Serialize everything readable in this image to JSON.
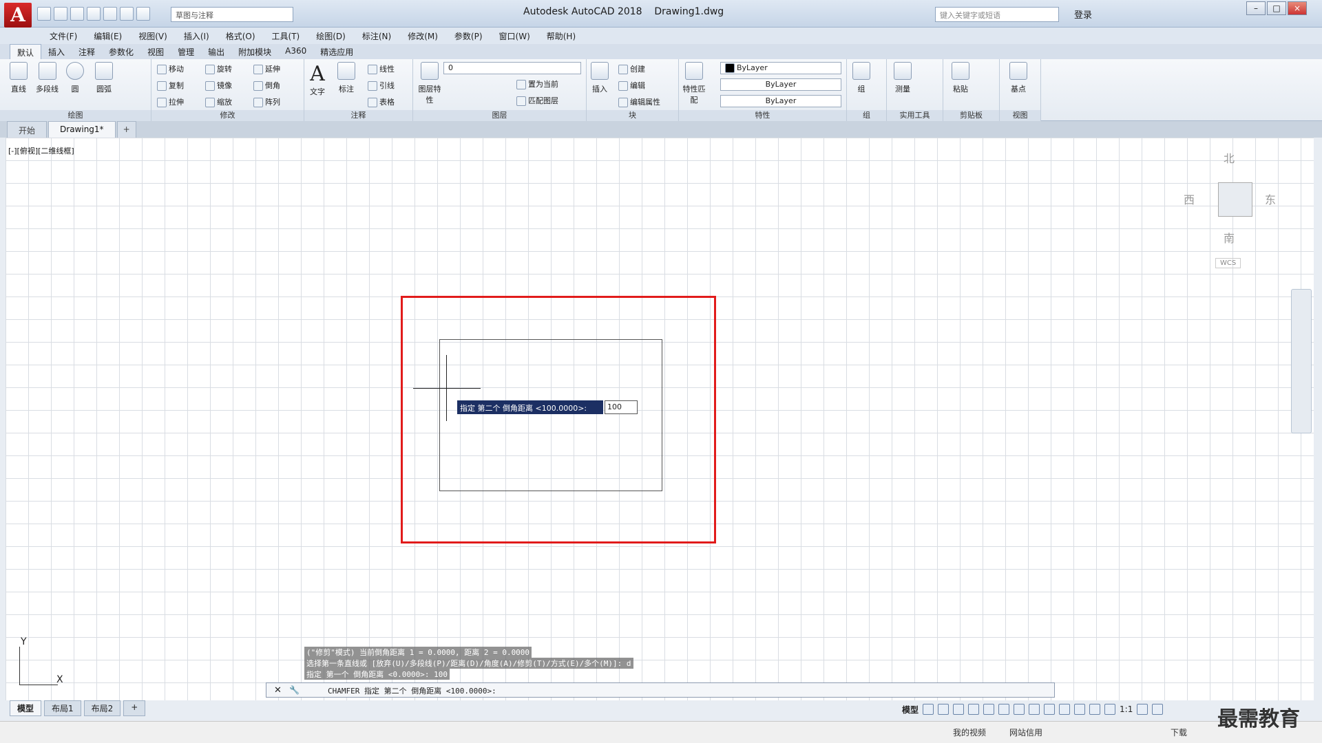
{
  "app": {
    "logo": "A",
    "title": "Autodesk AutoCAD 2018",
    "document": "Drawing1.dwg",
    "workspace": "草图与注释",
    "search_placeholder": "键入关键字或短语",
    "login": "登录"
  },
  "menu": [
    "文件(F)",
    "编辑(E)",
    "视图(V)",
    "插入(I)",
    "格式(O)",
    "工具(T)",
    "绘图(D)",
    "标注(N)",
    "修改(M)",
    "参数(P)",
    "窗口(W)",
    "帮助(H)"
  ],
  "ribbon_tabs": [
    "默认",
    "插入",
    "注释",
    "参数化",
    "视图",
    "管理",
    "输出",
    "附加模块",
    "A360",
    "精选应用"
  ],
  "panels": {
    "draw": {
      "title": "绘图",
      "tools": [
        "直线",
        "多段线",
        "圆",
        "圆弧"
      ]
    },
    "modify": {
      "title": "修改",
      "tools": [
        "移动",
        "旋转",
        "延伸",
        "复制",
        "镜像",
        "倒角",
        "拉伸",
        "缩放",
        "阵列"
      ]
    },
    "annotation": {
      "title": "注释",
      "tools": [
        "文字",
        "标注",
        "线性",
        "引线",
        "表格"
      ]
    },
    "layers": {
      "title": "图层",
      "tools": [
        "图层特性",
        "置为当前",
        "匹配图层"
      ],
      "current_layer": "0"
    },
    "block": {
      "title": "块",
      "tools": [
        "插入",
        "创建",
        "编辑",
        "编辑属性"
      ]
    },
    "properties": {
      "title": "特性",
      "tools": [
        "特性匹配"
      ],
      "color": "ByLayer",
      "linetype": "ByLayer",
      "lineweight": "ByLayer"
    },
    "groups": {
      "title": "组",
      "tools": [
        "组"
      ]
    },
    "utilities": {
      "title": "实用工具",
      "tools": [
        "测量"
      ]
    },
    "clipboard": {
      "title": "剪贴板",
      "tools": [
        "粘贴"
      ]
    },
    "view": {
      "title": "视图",
      "tools": [
        "基点"
      ]
    }
  },
  "doc_tabs": [
    "开始",
    "Drawing1*"
  ],
  "viewport_label": "[-][俯视][二维线框]",
  "viewcube": {
    "north": "北",
    "south": "南",
    "east": "东",
    "west": "西",
    "wcs": "WCS"
  },
  "dynamic_input": {
    "prompt": "指定 第二个 倒角距离 <100.0000>:",
    "value": "100"
  },
  "history": [
    "(\"修剪\"模式) 当前倒角距离 1 = 0.0000, 距离 2 = 0.0000",
    "选择第一条直线或 [放弃(U)/多段线(P)/距离(D)/角度(A)/修剪(T)/方式(E)/多个(M)]: d",
    "指定 第一个 倒角距离 <0.0000>: 100"
  ],
  "command_line": "CHAMFER 指定 第二个 倒角距离 <100.0000>:",
  "layout_tabs": [
    "模型",
    "布局1",
    "布局2"
  ],
  "status": {
    "mode": "模型",
    "scale": "1:1"
  },
  "taskbar": [
    "我的视频",
    "网站信用",
    "下载"
  ],
  "watermark": "最需教育",
  "ucs": {
    "x": "X",
    "y": "Y"
  }
}
